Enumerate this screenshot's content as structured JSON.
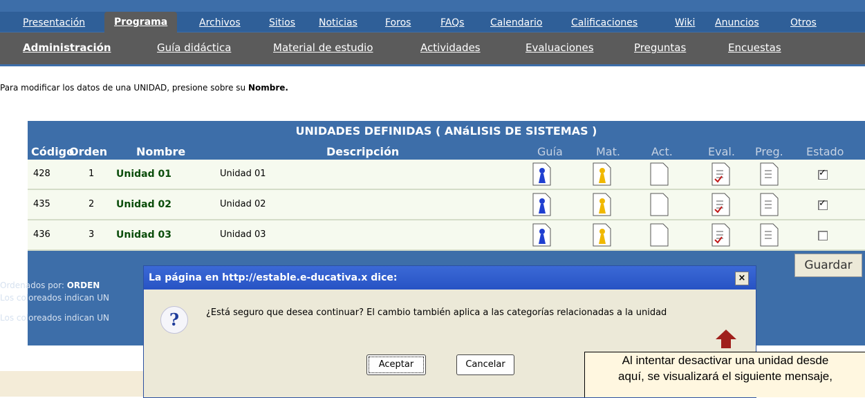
{
  "nav": {
    "tabs": [
      "Presentación",
      "Programa",
      "Archivos",
      "Sitios",
      "Noticias",
      "Foros",
      "FAQs",
      "Calendario",
      "Calificaciones",
      "Wiki",
      "Anuncios",
      "Otros"
    ],
    "active_tab": "Programa",
    "subtabs": [
      "Administración",
      "Guía didáctica",
      "Material de estudio",
      "Actividades",
      "Evaluaciones",
      "Preguntas",
      "Encuestas"
    ],
    "active_subtab": "Administración"
  },
  "intro": {
    "text": "Para modificar los datos de una UNIDAD, presione sobre su ",
    "bold": "Nombre."
  },
  "table": {
    "title": "UNIDADES DEFINIDAS ( ANáLISIS DE SISTEMAS )",
    "headers": [
      "Código",
      "Orden",
      "Nombre",
      "Descripción",
      "Guía",
      "Mat.",
      "Act.",
      "Eval.",
      "Preg.",
      "Estado"
    ],
    "rows": [
      {
        "codigo": "428",
        "orden": "1",
        "nombre": "Unidad 01",
        "descripcion": "Unidad 01",
        "estado": true
      },
      {
        "codigo": "435",
        "orden": "2",
        "nombre": "Unidad 02",
        "descripcion": "Unidad 02",
        "estado": true
      },
      {
        "codigo": "436",
        "orden": "3",
        "nombre": "Unidad 03",
        "descripcion": "Unidad 03",
        "estado": false
      }
    ],
    "save_label": "Guardar"
  },
  "legend": {
    "ordered_label": "Ordenados por: ",
    "ordered_value": "ORDEN",
    "line1": "Los coloreados indican UN",
    "line2": "Los coloreados indican UN"
  },
  "dialog": {
    "title": "La página en http://estable.e-ducativa.x dice:",
    "close": "×",
    "message": "¿Está seguro que desea continuar? El cambio también aplica a las categorías relacionadas a la unidad",
    "ok": "Aceptar",
    "cancel": "Cancelar"
  },
  "note": {
    "line1": "Al intentar desactivar una unidad desde",
    "line2": "aquí, se visualizará el siguiente mensaje,"
  },
  "colors": {
    "nav_blue": "#3d6ea9",
    "nav_gray": "#5b5b5b",
    "dialog_title": "#2753c4",
    "arrow": "#a0201c"
  }
}
